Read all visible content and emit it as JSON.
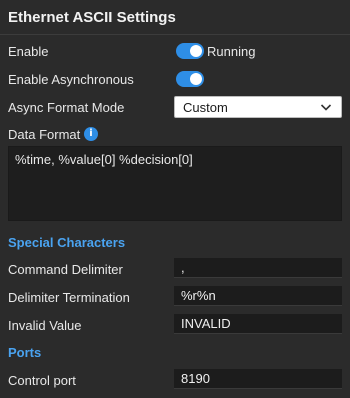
{
  "title": "Ethernet ASCII Settings",
  "enable": {
    "label": "Enable",
    "on": true,
    "status": "Running"
  },
  "async": {
    "label": "Enable Asynchronous",
    "on": true
  },
  "format_mode": {
    "label": "Async Format Mode",
    "value": "Custom"
  },
  "data_format": {
    "label": "Data Format",
    "value": "%time, %value[0] %decision[0]"
  },
  "special": {
    "heading": "Special Characters",
    "command_delimiter": {
      "label": "Command Delimiter",
      "value": ","
    },
    "delimiter_termination": {
      "label": "Delimiter Termination",
      "value": "%r%n"
    },
    "invalid_value": {
      "label": "Invalid Value",
      "value": "INVALID"
    }
  },
  "ports": {
    "heading": "Ports",
    "control_port": {
      "label": "Control port",
      "value": "8190"
    }
  },
  "colors": {
    "accent": "#2e8ee6",
    "section": "#4aa3f0",
    "background": "#2b2b2b"
  },
  "icons": {
    "info": "info-icon",
    "dropdown": "chevron-down-icon"
  }
}
